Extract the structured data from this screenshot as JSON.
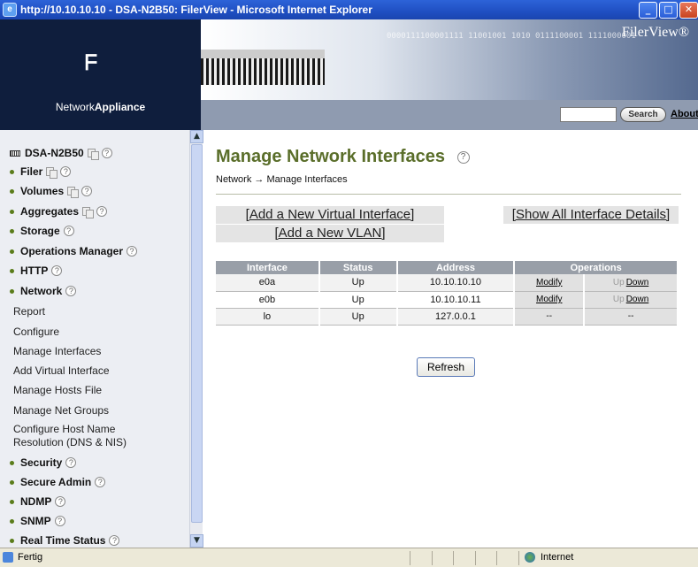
{
  "window": {
    "title": "http://10.10.10.10 - DSA-N2B50: FilerView - Microsoft Internet Explorer",
    "minimize": "_",
    "maximize": "□",
    "close": "✕"
  },
  "header": {
    "brand_prefix": "Network",
    "brand_bold": "Appliance",
    "logo_mark": "ᖴ",
    "product": "FilerView®",
    "banner_bits": "0000111100001111 11001001 1010 0111100001 1111000001",
    "search_placeholder": "",
    "search_label": "Search",
    "about_label": "About"
  },
  "sidebar": {
    "root": "DSA-N2B50",
    "items": [
      {
        "label": "Filer",
        "pages": true
      },
      {
        "label": "Volumes",
        "pages": true
      },
      {
        "label": "Aggregates",
        "pages": true
      },
      {
        "label": "Storage",
        "pages": false
      },
      {
        "label": "Operations Manager",
        "pages": false
      },
      {
        "label": "HTTP",
        "pages": false
      },
      {
        "label": "Network",
        "pages": false
      }
    ],
    "network_sub": [
      "Report",
      "Configure",
      "Manage Interfaces",
      "Add Virtual Interface",
      "Manage Hosts File",
      "Manage Net Groups",
      "Configure Host Name",
      "Resolution (DNS & NIS)"
    ],
    "items_after": [
      {
        "label": "Security"
      },
      {
        "label": "Secure Admin"
      },
      {
        "label": "NDMP"
      },
      {
        "label": "SNMP"
      },
      {
        "label": "Real Time Status"
      }
    ]
  },
  "main": {
    "title": "Manage Network Interfaces",
    "breadcrumb": "Network → Manage Interfaces",
    "add_virtual_label": "[Add a New Virtual Interface]",
    "add_vlan_label": "[Add a New VLAN]",
    "show_all_label": "[Show All Interface Details]",
    "table": {
      "headers": [
        "Interface",
        "Status",
        "Address",
        "Operations"
      ],
      "rows": [
        {
          "interface": "e0a",
          "status": "Up",
          "address": "10.10.10.10",
          "op1": "Modify",
          "op2_prefix": "Up",
          "op2_link": "Down"
        },
        {
          "interface": "e0b",
          "status": "Up",
          "address": "10.10.10.11",
          "op1": "Modify",
          "op2_prefix": "Up",
          "op2_link": "Down"
        },
        {
          "interface": "lo",
          "status": "Up",
          "address": "127.0.0.1",
          "op1": "--",
          "op2_prefix": "",
          "op2_link": "--"
        }
      ]
    },
    "refresh_label": "Refresh"
  },
  "statusbar": {
    "status": "Fertig",
    "zone": "Internet"
  },
  "colors": {
    "title_bar": "#1f4fc2",
    "page_title": "#5a6e2a",
    "table_header": "#999fa8",
    "sidebar_bg": "#eceef3"
  }
}
